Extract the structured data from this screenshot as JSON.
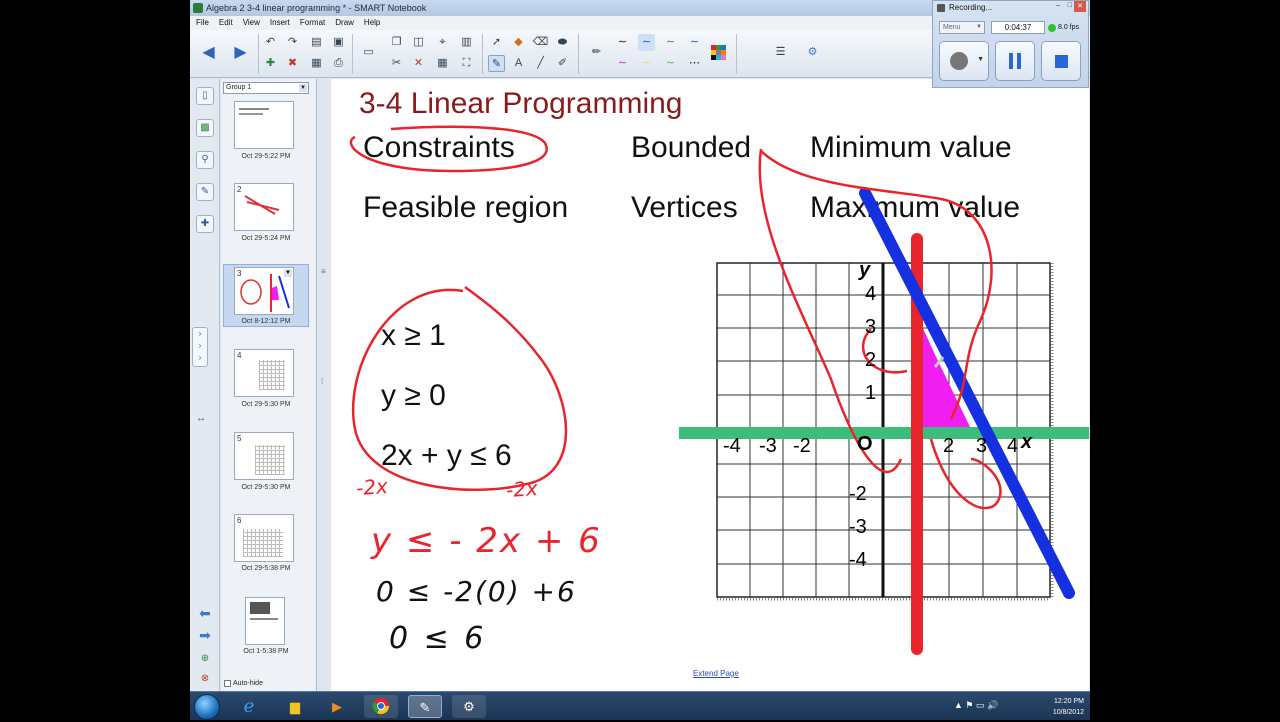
{
  "window": {
    "title": "Algebra 2 3-4 linear programming * - SMART Notebook",
    "controls": [
      "–",
      "□",
      "✕"
    ]
  },
  "menu": [
    "File",
    "Edit",
    "View",
    "Insert",
    "Format",
    "Draw",
    "Help"
  ],
  "toolbar": {
    "icons": [
      "back-icon",
      "forward-icon",
      "undo-icon",
      "redo-icon",
      "new-page-icon",
      "open-icon",
      "screenshade-icon",
      "paste-icon",
      "delete-icon",
      "table-icon",
      "select-icon",
      "pen-icon",
      "text-icon",
      "line-icon",
      "eraser-icon",
      "color-palette-icon",
      "properties-icon"
    ]
  },
  "sidebar_tabs": [
    "page-sorter-icon",
    "gallery-icon",
    "attachments-icon",
    "properties-icon",
    "addons-icon"
  ],
  "pages": {
    "group": "Group 1",
    "items": [
      {
        "num": "",
        "date": "Oct 29-5:22 PM"
      },
      {
        "num": "2",
        "date": "Oct 29-5:24 PM"
      },
      {
        "num": "3",
        "date": "Oct 8-12:12 PM",
        "selected": true
      },
      {
        "num": "4",
        "date": "Oct 29-5:30 PM"
      },
      {
        "num": "5",
        "date": "Oct 29-5:30 PM"
      },
      {
        "num": "6",
        "date": "Oct 29-5:38 PM"
      },
      {
        "num": "",
        "date": "Oct 1-5:38 PM"
      }
    ],
    "autohide_label": "Auto-hide"
  },
  "slide": {
    "title": "3-4 Linear Programming",
    "terms": {
      "constraints": "Constraints",
      "bounded": "Bounded",
      "minimum": "Minimum value",
      "feasible": "Feasible region",
      "vertices": "Vertices",
      "maximum": "Maximum value"
    },
    "inequalities": [
      "x ≥ 1",
      "y ≥ 0",
      "2x + y ≤ 6"
    ],
    "handwriting": {
      "minus1": "-2x",
      "minus2": "-2x",
      "step1": "y ≤ - 2x + 6",
      "step2": "0 ≤ -2(0) +6",
      "step3": "0 ≤ 6"
    },
    "graph": {
      "y_label": "y",
      "x_label": "x",
      "y_ticks": [
        "4",
        "3",
        "2",
        "1",
        "-2",
        "-3",
        "-4"
      ],
      "x_ticks": [
        "-4",
        "-3",
        "-2",
        "2",
        "3",
        "4"
      ],
      "origin": "O"
    },
    "extend_page": "Extend Page"
  },
  "recorder": {
    "title": "Recording...",
    "menu": "Menu",
    "time": "0:04:37",
    "fps": "8.0 fps"
  },
  "taskbar": {
    "apps": [
      "ie-icon",
      "explorer-icon",
      "media-player-icon",
      "chrome-icon",
      "notebook-icon",
      "recorder-icon"
    ],
    "time": "12:20 PM",
    "date": "10/8/2012"
  },
  "colors": {
    "title": "#8b1a1a",
    "red_ink": "#e8242c",
    "blue_line": "#1530e0",
    "green_line": "#3dbd7a",
    "feasible_fill": "#f01ef0"
  }
}
